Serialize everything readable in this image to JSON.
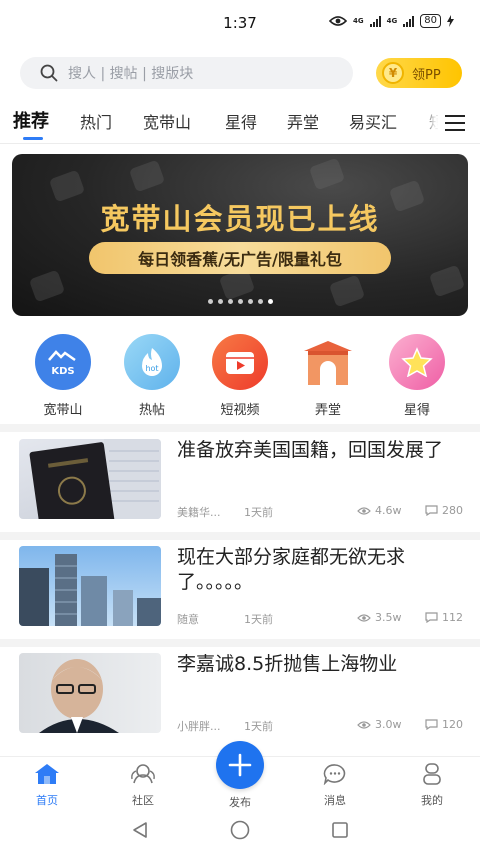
{
  "status": {
    "time": "1:37",
    "network": "4G",
    "battery": "80"
  },
  "search": {
    "placeholder": "搜人 | 搜帖 | 搜版块",
    "reward_label": "领PP",
    "coin_symbol": "¥"
  },
  "tabs": [
    "推荐",
    "热门",
    "宽带山",
    "星得",
    "弄堂",
    "易买汇",
    "短"
  ],
  "banner": {
    "headline": "宽带山会员现已上线",
    "subline": "每日领香蕉/无广告/限量礼包",
    "dot_count": 7,
    "active_dot": 6
  },
  "categories": [
    {
      "label": "宽带山",
      "badge": "KDS",
      "color": "#3f82e8"
    },
    {
      "label": "热帖",
      "badge": "hot",
      "color": "#7cc6f0"
    },
    {
      "label": "短视频",
      "badge": "",
      "color": "#f1552f"
    },
    {
      "label": "弄堂",
      "badge": "",
      "color": "#f08a5d"
    },
    {
      "label": "星得",
      "badge": "",
      "color": "#f07ab5"
    }
  ],
  "news": [
    {
      "title": "准备放弃美国国籍，回国发展了",
      "source": "美籍华...",
      "time": "1天前",
      "views": "4.6w",
      "comments": "280"
    },
    {
      "title": "现在大部分家庭都无欲无求了。。。。。",
      "source": "随意",
      "time": "1天前",
      "views": "3.5w",
      "comments": "112"
    },
    {
      "title": "李嘉诚8.5折抛售上海物业",
      "source": "小胖胖...",
      "time": "1天前",
      "views": "3.0w",
      "comments": "120"
    }
  ],
  "bottom_nav": [
    {
      "label": "首页",
      "active": true
    },
    {
      "label": "社区",
      "active": false
    },
    {
      "label": "发布",
      "active": false
    },
    {
      "label": "消息",
      "active": false
    },
    {
      "label": "我的",
      "active": false
    }
  ],
  "colors": {
    "accent": "#2e7cf6",
    "reward": "#ffc400",
    "banner_gold": "#f5c860"
  }
}
